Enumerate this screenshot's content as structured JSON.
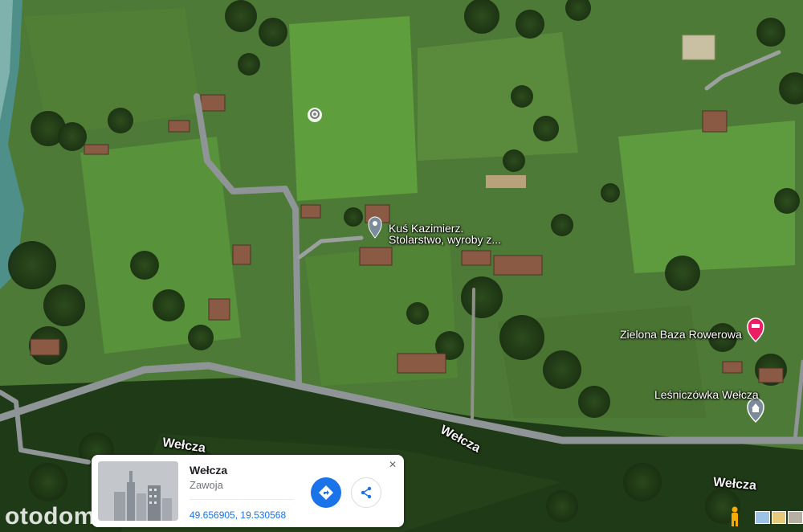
{
  "map": {
    "labels": {
      "road_1": "Wełcza",
      "road_2": "Wełcza",
      "road_3": "Wełcza",
      "poi_business_line1": "Kuś Kazimierz.",
      "poi_business_line2": "Stolarstwo, wyroby z...",
      "poi_bike": "Zielona Baza Rowerowa",
      "poi_forester": "Leśniczówka Wełcza"
    }
  },
  "place_card": {
    "title": "Wełcza",
    "subtitle": "Zawoja",
    "coords": "49.656905, 19.530568",
    "close_glyph": "×"
  },
  "watermark": "otodom",
  "colors": {
    "accent": "#1a73e8",
    "poi_pink": "#e91e63",
    "poi_gray": "#7a8b99"
  }
}
